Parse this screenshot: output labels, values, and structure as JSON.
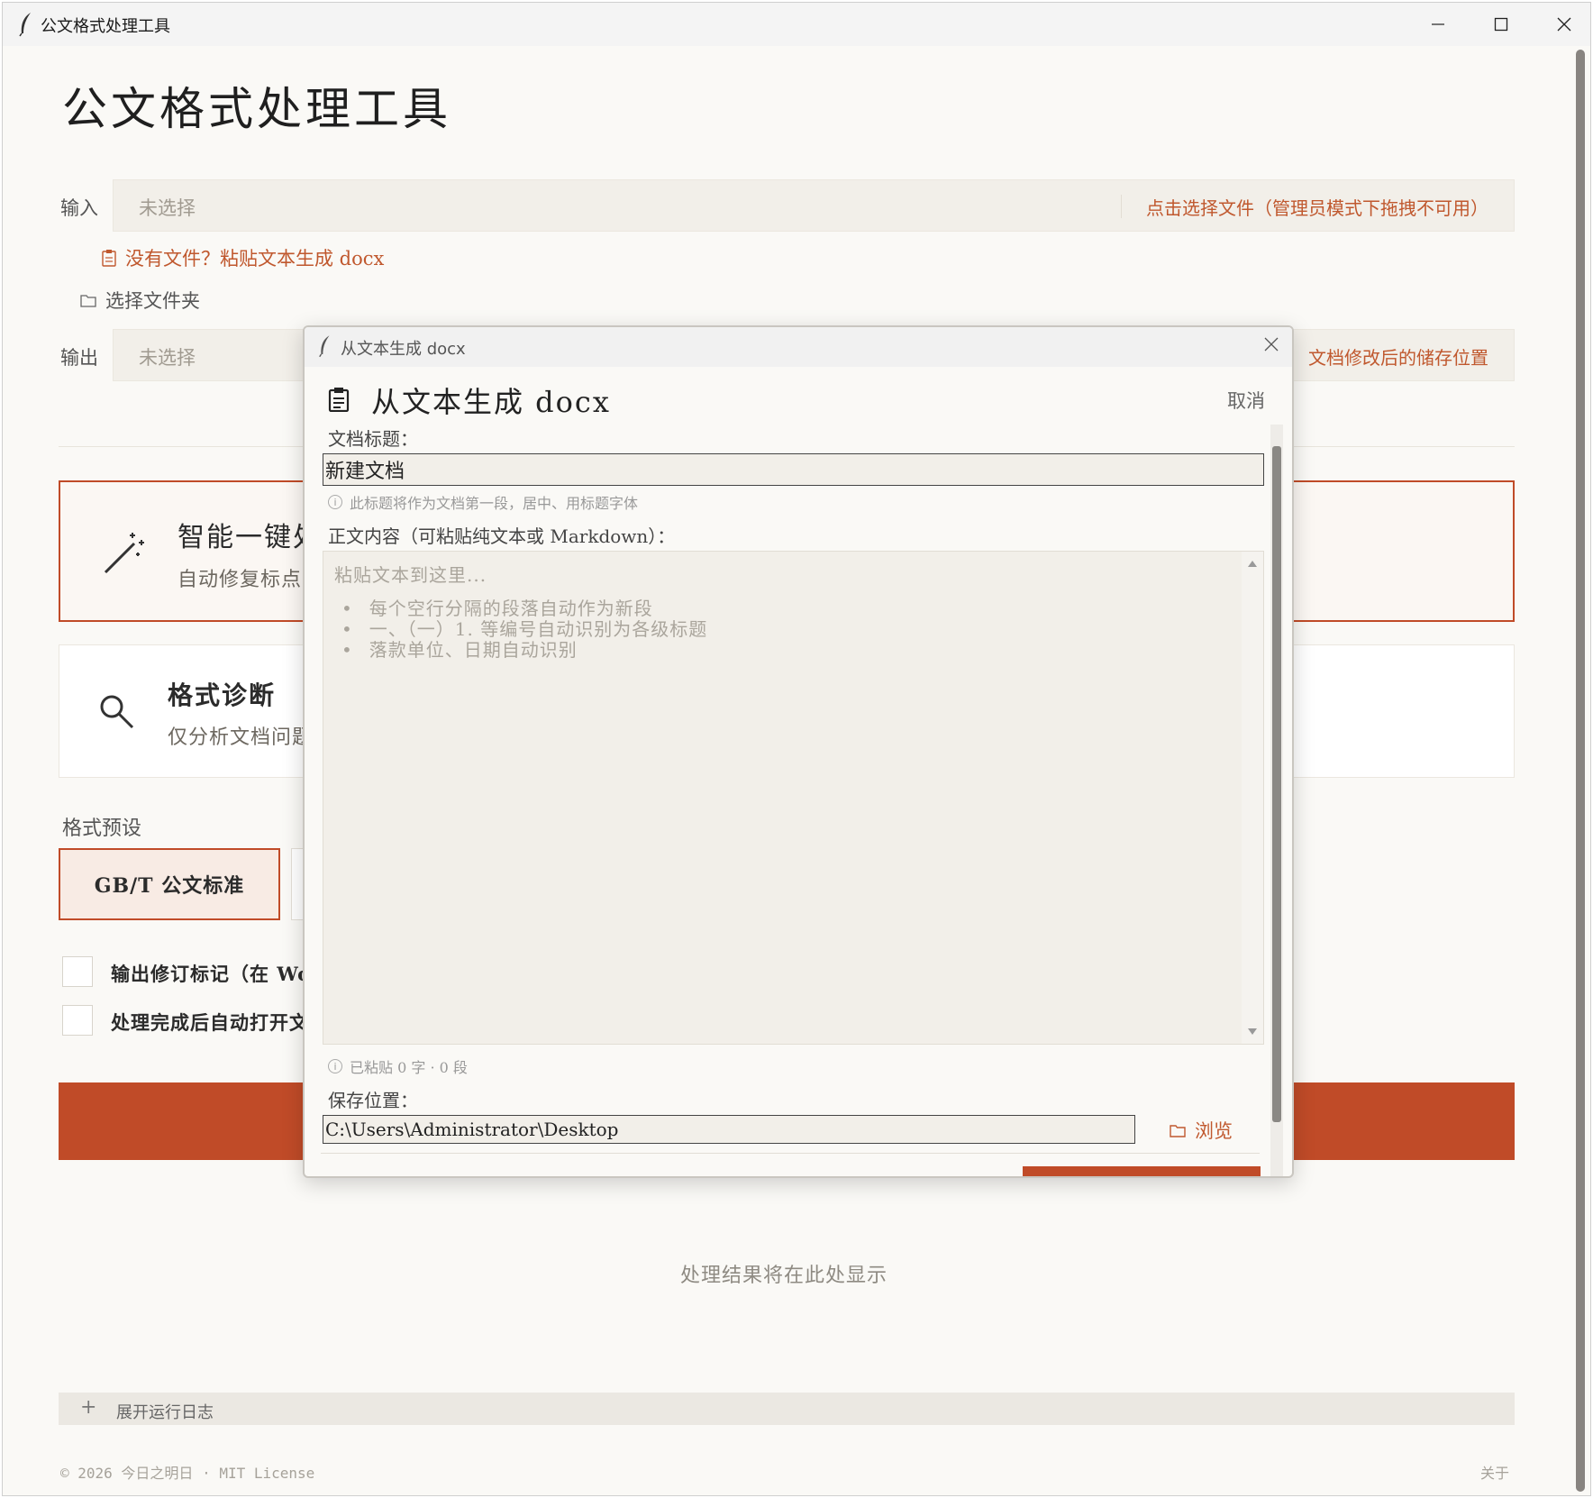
{
  "window": {
    "title": "公文格式处理工具"
  },
  "main": {
    "title": "公文格式处理工具",
    "input": {
      "label": "输入",
      "placeholder": "未选择",
      "action": "点击选择文件（管理员模式下拖拽不可用）"
    },
    "paste_link": "没有文件？粘贴文本生成 docx",
    "folder_link": "选择文件夹",
    "output": {
      "label": "输出",
      "placeholder": "未选择",
      "action": "文档修改后的储存位置"
    },
    "cards": [
      {
        "title": "智能一键处理",
        "desc": "自动修复标点"
      },
      {
        "title": "格式诊断",
        "desc": "仅分析文档问题"
      }
    ],
    "preset_label": "格式预设",
    "presets": [
      {
        "label": "GB/T 公文标准",
        "selected": true
      }
    ],
    "options": [
      {
        "label": "输出修订标记（在 Word"
      },
      {
        "label": "处理完成后自动打开文"
      }
    ],
    "result_placeholder": "处理结果将在此处显示",
    "log_toggle": "展开运行日志",
    "footer_left": "© 2026 今日之明日 · MIT License",
    "footer_right": "关于"
  },
  "dialog": {
    "window_title": "从文本生成 docx",
    "header_title": "从文本生成 docx",
    "cancel_top": "取消",
    "doc_title_label": "文档标题：",
    "doc_title_value": "新建文档",
    "doc_title_hint": "此标题将作为文档第一段，居中、用标题字体",
    "body_label": "正文内容（可粘贴纯文本或 Markdown）：",
    "body_placeholder": "粘贴文本到这里...",
    "body_tips": [
      "每个空行分隔的段落自动作为新段",
      "一、（一）1. 等编号自动识别为各级标题",
      "落款单位、日期自动识别"
    ],
    "count_hint": "已粘贴 0 字 · 0 段",
    "save_label": "保存位置：",
    "save_path": "C:\\Users\\Administrator\\Desktop",
    "browse": "浏览"
  },
  "colors": {
    "accent": "#c04b28",
    "accent_text": "#c0582e",
    "background": "#faf9f6",
    "field": "#f2efe9"
  }
}
